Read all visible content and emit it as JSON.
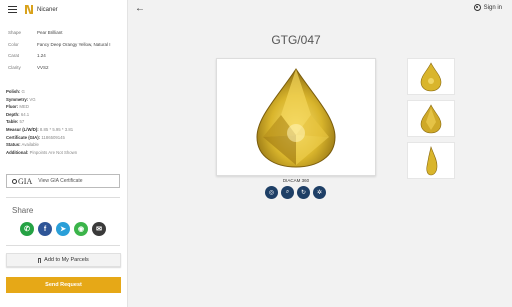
{
  "app": {
    "name": "Nicaner"
  },
  "specs": [
    {
      "label": "Shape",
      "value": "Pear Brilliant"
    },
    {
      "label": "Color",
      "value": "Fancy Deep Orangy Yellow, Natural I"
    },
    {
      "label": "Carat",
      "value": "1.24"
    },
    {
      "label": "Clarity",
      "value": "VVS2"
    }
  ],
  "details": [
    {
      "label": "Polish:",
      "value": "G"
    },
    {
      "label": "Symmetry:",
      "value": "VG"
    },
    {
      "label": "Fluor:",
      "value": "MED"
    },
    {
      "label": "Depth:",
      "value": "64.1"
    },
    {
      "label": "Table:",
      "value": "57"
    },
    {
      "label": "Measur (L/W/D):",
      "value": "8.85 * 5.95 * 3.81"
    },
    {
      "label": "Certificate (GIA):",
      "value": "1186509145"
    },
    {
      "label": "Status:",
      "value": "Available"
    },
    {
      "label": "Additional:",
      "value": "Pinpoints Are Not Shown"
    }
  ],
  "gia": {
    "logo": "GIA",
    "label": "View GIA Certificate"
  },
  "share": {
    "label": "Share",
    "icons": [
      {
        "name": "whatsapp-icon",
        "color": "#25a244",
        "glyph": "✆"
      },
      {
        "name": "facebook-icon",
        "color": "#2f5597",
        "glyph": "f"
      },
      {
        "name": "telegram-icon",
        "color": "#2a9fd8",
        "glyph": "➤"
      },
      {
        "name": "wechat-icon",
        "color": "#3bb44a",
        "glyph": "◉"
      },
      {
        "name": "email-icon",
        "color": "#3a3a3a",
        "glyph": "✉"
      }
    ]
  },
  "actions": {
    "parcels": "Add to My Parcels",
    "send": "Send Request"
  },
  "header": {
    "signin": "Sign in"
  },
  "product": {
    "stock_id": "GTG/047",
    "caption": "DIACAM 360",
    "gem_color": "#d9b52c"
  }
}
